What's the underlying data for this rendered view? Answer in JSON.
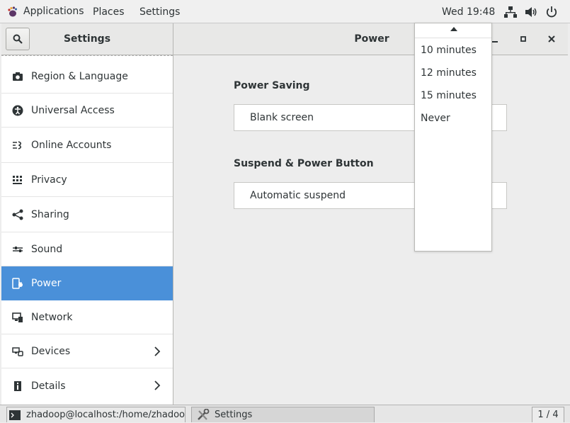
{
  "topbar": {
    "applications": "Applications",
    "places": "Places",
    "settings": "Settings",
    "clock": "Wed 19:48",
    "icons": [
      "network-icon",
      "volume-icon",
      "power-icon"
    ]
  },
  "window": {
    "sidebar_title": "Settings",
    "panel_title": "Power"
  },
  "sidebar": {
    "items": [
      {
        "label": "Region & Language",
        "icon": "camera-icon"
      },
      {
        "label": "Universal Access",
        "icon": "accessibility-icon"
      },
      {
        "label": "Online Accounts",
        "icon": "online-accounts-icon"
      },
      {
        "label": "Privacy",
        "icon": "privacy-icon"
      },
      {
        "label": "Sharing",
        "icon": "sharing-icon"
      },
      {
        "label": "Sound",
        "icon": "sound-icon"
      },
      {
        "label": "Power",
        "icon": "power-plug-icon"
      },
      {
        "label": "Network",
        "icon": "network-icon"
      },
      {
        "label": "Devices",
        "icon": "devices-icon"
      },
      {
        "label": "Details",
        "icon": "info-icon"
      }
    ],
    "active": "Power"
  },
  "content": {
    "power_saving_title": "Power Saving",
    "blank_screen_label": "Blank screen",
    "suspend_title": "Suspend & Power Button",
    "automatic_suspend_label": "Automatic suspend"
  },
  "popover": {
    "options": [
      "10 minutes",
      "12 minutes",
      "15 minutes",
      "Never"
    ]
  },
  "taskbar": {
    "terminal": "zhadoop@localhost:/home/zhadoop",
    "settings": "Settings",
    "workspace": "1 / 4"
  },
  "colors": {
    "accent": "#4a90d9",
    "panel_bg": "#ededed"
  }
}
